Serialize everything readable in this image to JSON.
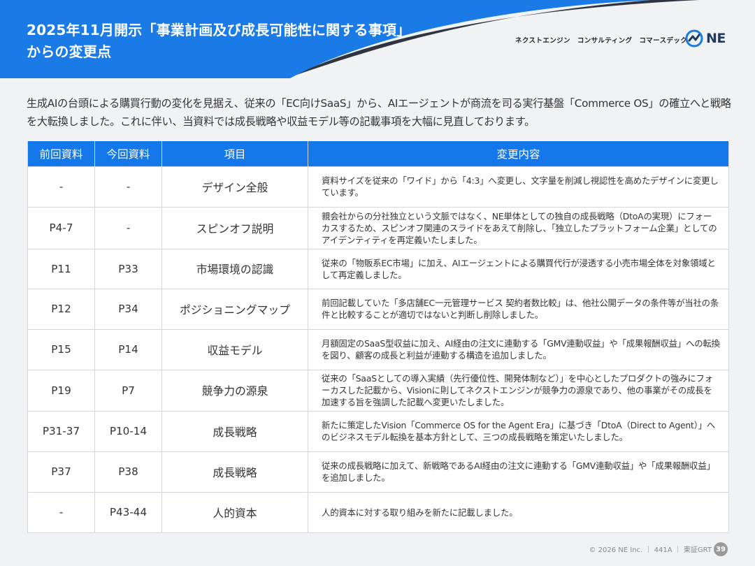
{
  "header": {
    "title_line1": "2025年11月開示「事業計画及び成長可能性に関する事項」",
    "title_line2": "からの変更点",
    "brand_text": "ネクストエンジン　コンサルティング　コマースデック",
    "logo_text": "NE",
    "colors": {
      "blue": "#1a7ae6",
      "dark": "#2f3540"
    }
  },
  "intro": "生成AIの台頭による購買行動の変化を見据え、従来の「EC向けSaaS」から、AIエージェントが商流を司る実行基盤「Commerce OS」の確立へと戦略を大転換しました。これに伴い、当資料では成長戦略や収益モデル等の記載事項を大幅に見直しております。",
  "table": {
    "headers": [
      "前回資料",
      "今回資料",
      "項目",
      "変更内容"
    ],
    "rows": [
      {
        "prev": "-",
        "curr": "-",
        "item": "デザイン全般",
        "desc": "資料サイズを従来の「ワイド」から「4:3」へ変更し、文字量を削減し視認性を高めたデザインに変更しています。"
      },
      {
        "prev": "P4-7",
        "curr": "-",
        "item": "スピンオフ説明",
        "desc": "親会社からの分社独立という文脈ではなく、NE単体としての独自の成長戦略（DtoAの実現）にフォーカスするため、スピンオフ関連のスライドをあえて削除し、「独立したプラットフォーム企業」としてのアイデンティティを再定義いたしました。"
      },
      {
        "prev": "P11",
        "curr": "P33",
        "item": "市場環境の認識",
        "desc": "従来の「物販系EC市場」に加え、AIエージェントによる購買代行が浸透する小売市場全体を対象領域として再定義しました。"
      },
      {
        "prev": "P12",
        "curr": "P34",
        "item": "ポジショニングマップ",
        "desc": "前回記載していた「多店舗EC一元管理サービス 契約者数比較」は、他社公開データの条件等が当社の条件と比較することが適切ではないと判断し削除しました。"
      },
      {
        "prev": "P15",
        "curr": "P14",
        "item": "収益モデル",
        "desc": "月額固定のSaaS型収益に加え、AI経由の注文に連動する「GMV連動収益」や「成果報酬収益」への転換を図り、顧客の成長と利益が連動する構造を追加しました。"
      },
      {
        "prev": "P19",
        "curr": "P7",
        "item": "競争力の源泉",
        "desc": "従来の「SaaSとしての導入実績（先行優位性、開発体制など）」を中心としたプロダクトの強みにフォーカスした記載から、Visionに則してネクストエンジンが競争力の源泉であり、他の事業がその成長を加速する旨を強調した記載へ変更いたしました。"
      },
      {
        "prev": "P31-37",
        "curr": "P10-14",
        "item": "成長戦略",
        "desc": "新たに策定したVision「Commerce OS for the Agent Era」に基づき「DtoA（Direct to Agent）」へのビジネスモデル転換を基本方針として、三つの成長戦略を策定いたしました。"
      },
      {
        "prev": "P37",
        "curr": "P38",
        "item": "成長戦略",
        "desc": "従来の成長戦略に加えて、新戦略であるAI経由の注文に連動する「GMV連動収益」や「成果報酬収益」を追加しました。"
      },
      {
        "prev": "-",
        "curr": "P43-44",
        "item": "人的資本",
        "desc": "人的資本に対する取り組みを新たに記載しました。"
      }
    ]
  },
  "footer": {
    "copyright": "© 2026 NE Inc.",
    "code": "441A",
    "market": "東証GRT",
    "page": "39"
  }
}
